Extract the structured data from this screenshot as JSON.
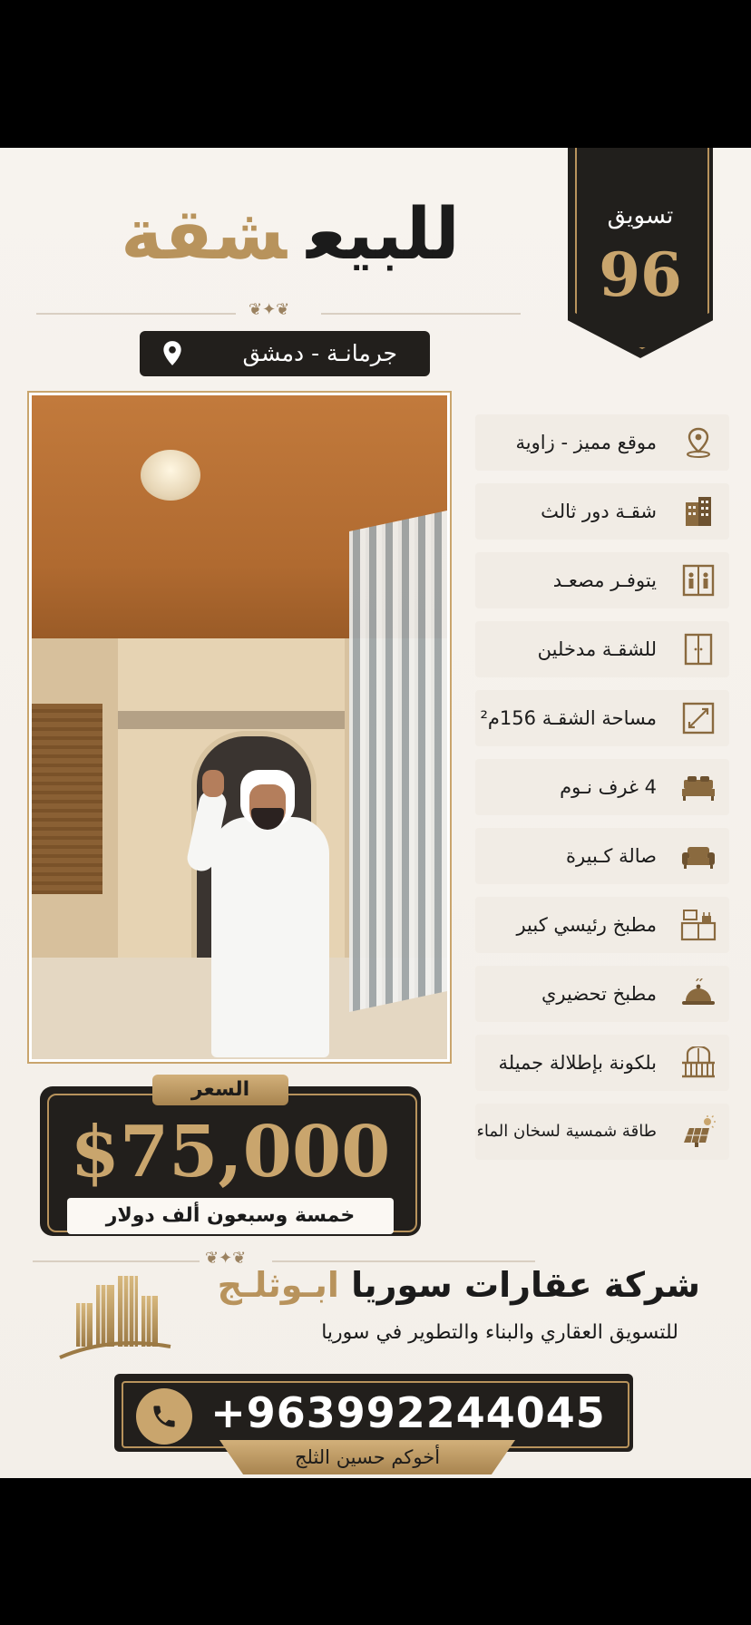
{
  "header": {
    "title_word1": "للبيع",
    "title_word2": "شقة",
    "badge_label": "تسويق",
    "badge_number": "96"
  },
  "location": {
    "text": "جرمانـة - دمشق",
    "icon": "location-pin-icon"
  },
  "features": [
    {
      "label": "موقع مميز - زاوية",
      "icon": "location-pin-icon"
    },
    {
      "label": "شقـة دور ثالث",
      "icon": "building-icon"
    },
    {
      "label": "يتوفـر مصعـد",
      "icon": "elevator-icon"
    },
    {
      "label": "للشقـة مدخلين",
      "icon": "double-door-icon"
    },
    {
      "label": "مساحة الشقـة 156م²",
      "icon": "area-icon"
    },
    {
      "label": "4 غرف نـوم",
      "icon": "bed-icon"
    },
    {
      "label": "صالة كـبيرة",
      "icon": "sofa-icon"
    },
    {
      "label": "مطبخ رئيسي كبير",
      "icon": "kitchen-icon"
    },
    {
      "label": "مطبخ تحضيري",
      "icon": "food-tray-icon"
    },
    {
      "label": "بلكونة بإطلالة جميلة",
      "icon": "balcony-icon"
    },
    {
      "label": "طاقة شمسية لسخان الماء",
      "icon": "solar-panel-icon"
    }
  ],
  "price": {
    "label": "السعر",
    "value": "$75,000",
    "in_words": "خمسة وسبعون ألف دولار"
  },
  "company": {
    "name_part1": "شركة عقارات سوريا",
    "name_part2": "ابـوثلـج",
    "tagline": "للتسويق العقاري والبناء والتطوير في سوريا",
    "phone": "+963992244045",
    "signature": "أخوكم حسين الثلج",
    "logo_icon": "buildings-logo-icon",
    "phone_icon": "phone-icon"
  },
  "colors": {
    "gold": "#b8935c",
    "dark": "#221f1c",
    "background": "#f5f1eb"
  }
}
